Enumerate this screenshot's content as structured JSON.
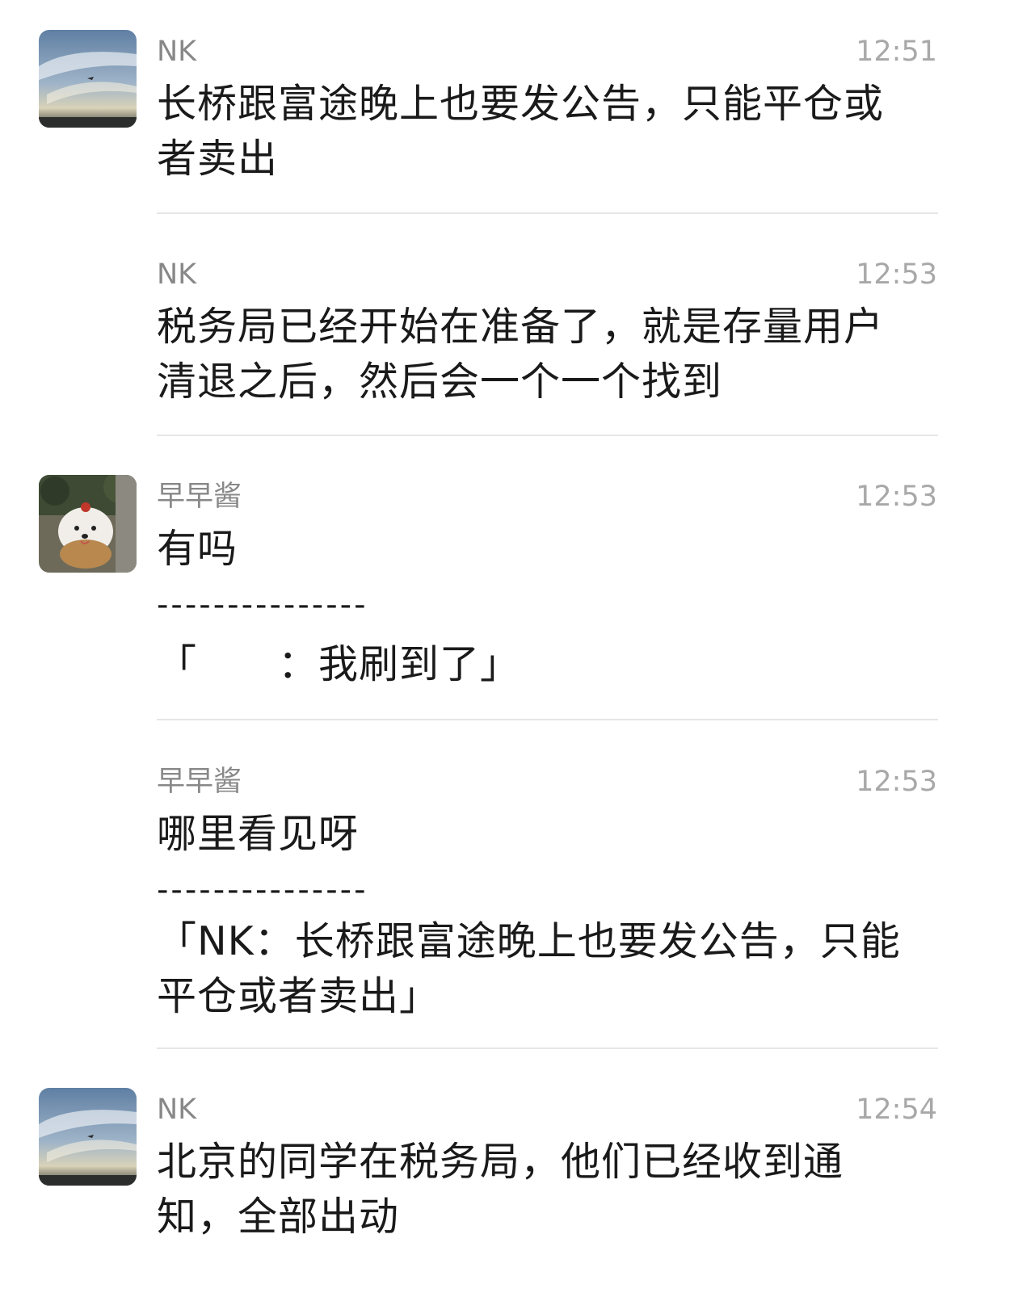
{
  "messages": [
    {
      "sender": "NK",
      "time": "12:51",
      "text": "长桥跟富途晚上也要发公告，只能平仓或者卖出"
    },
    {
      "sender": "NK",
      "time": "12:53",
      "text": "税务局已经开始在准备了，就是存量用户清退之后，然后会一个一个找到"
    },
    {
      "sender": "早早酱",
      "time": "12:53",
      "text": "有吗",
      "separator": "---------------",
      "quote": "「　　：我刷到了」"
    },
    {
      "sender": "早早酱",
      "time": "12:53",
      "text": "哪里看见呀",
      "separator": "---------------",
      "quote": "「NK：长桥跟富途晚上也要发公告，只能平仓或者卖出」"
    },
    {
      "sender": "NK",
      "time": "12:54",
      "text": "北京的同学在税务局，他们已经收到通知，全部出动"
    }
  ],
  "avatars": {
    "nk": "sky-airplane-photo",
    "zaozaojiang": "white-dog-photo"
  }
}
